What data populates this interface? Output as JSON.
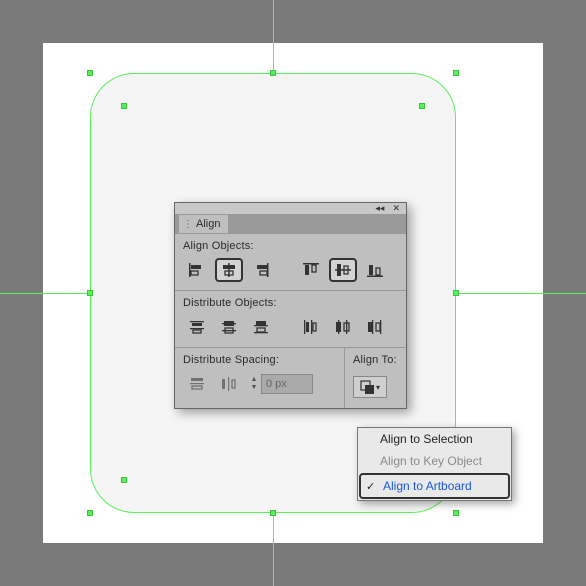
{
  "panel": {
    "title": "Align",
    "sections": {
      "alignObjects": "Align Objects:",
      "distributeObjects": "Distribute Objects:",
      "distributeSpacing": "Distribute Spacing:",
      "alignTo": "Align To:"
    },
    "spacingValue": "0 px"
  },
  "dropdown": {
    "items": [
      {
        "label": "Align to Selection",
        "enabled": true,
        "checked": false
      },
      {
        "label": "Align to Key Object",
        "enabled": false,
        "checked": false
      },
      {
        "label": "Align to Artboard",
        "enabled": true,
        "checked": true
      }
    ]
  },
  "guides": {
    "hCenterY": 293,
    "vCenterX": 273
  },
  "shape": {
    "selected": true
  }
}
